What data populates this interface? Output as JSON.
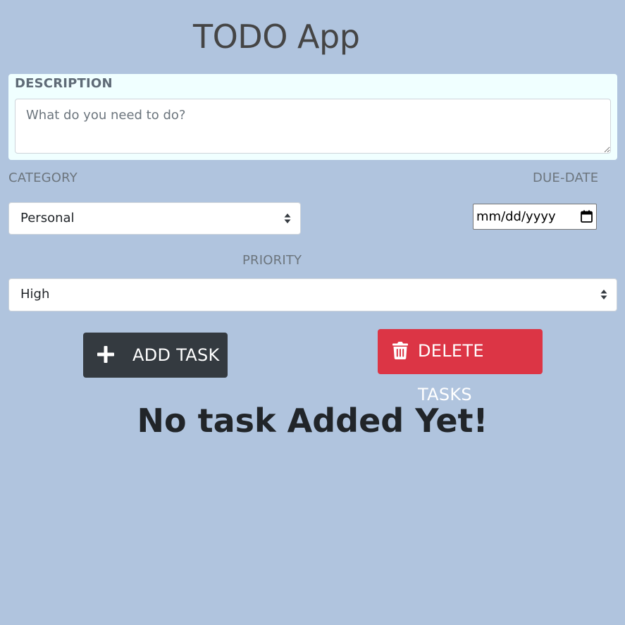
{
  "app": {
    "title": "TODO App"
  },
  "form": {
    "description": {
      "label": "DESCRIPTION",
      "placeholder": "What do you need to do?",
      "value": ""
    },
    "category": {
      "label": "CATEGORY",
      "selected": "Personal"
    },
    "due_date": {
      "label": "DUE-DATE",
      "display": "mm/dd/yyyy",
      "icon": "calendar-icon"
    },
    "priority": {
      "label": "PRIORITY",
      "selected": "High"
    }
  },
  "actions": {
    "add": {
      "label": "ADD TASK",
      "icon": "plus-icon"
    },
    "delete": {
      "label": "DELETE TASKS",
      "icon": "trash-icon"
    }
  },
  "tasks": {
    "empty_message": "No task Added Yet!",
    "items": []
  },
  "colors": {
    "background": "#b0c4de",
    "description_card": "#f0ffff",
    "add_button": "#343a40",
    "delete_button": "#dc3545"
  }
}
